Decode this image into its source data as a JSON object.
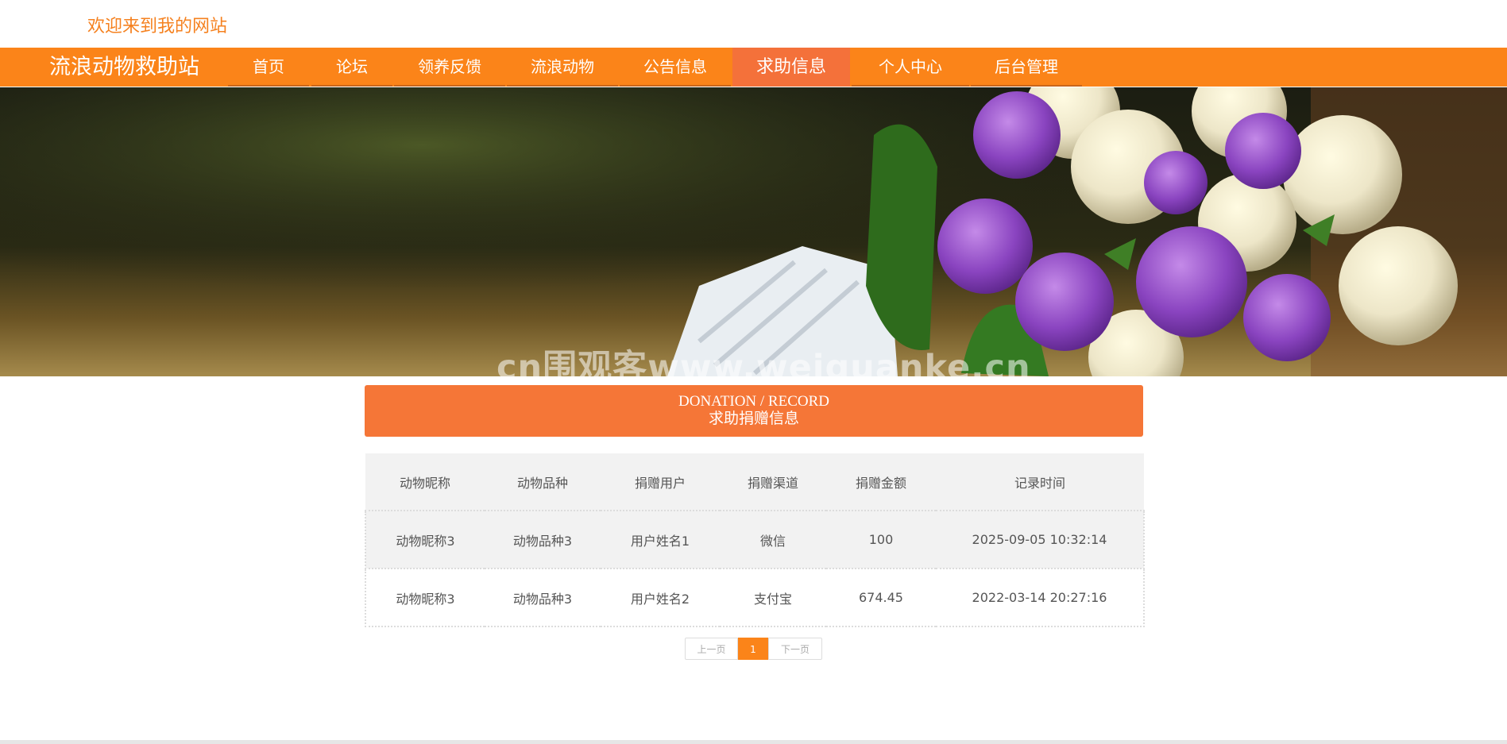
{
  "header": {
    "welcome": "欢迎来到我的网站"
  },
  "nav": {
    "site_title": "流浪动物救助站",
    "items": [
      {
        "label": "首页"
      },
      {
        "label": "论坛"
      },
      {
        "label": "领养反馈"
      },
      {
        "label": "流浪动物"
      },
      {
        "label": "公告信息"
      },
      {
        "label": "求助信息",
        "active": true
      },
      {
        "label": "个人中心"
      },
      {
        "label": "后台管理"
      }
    ],
    "color": "#fb8419",
    "active_color": "#f4713a"
  },
  "banner": {
    "watermark": "cn围观客www.weiguanke.cn"
  },
  "section": {
    "title_en": "DONATION / RECORD",
    "title_cn": "求助捐赠信息",
    "color": "#f57637"
  },
  "table": {
    "headers": [
      "动物昵称",
      "动物品种",
      "捐赠用户",
      "捐赠渠道",
      "捐赠金额",
      "记录时间"
    ],
    "rows": [
      [
        "动物昵称3",
        "动物品种3",
        "用户姓名1",
        "微信",
        "100",
        "2025-09-05 10:32:14"
      ],
      [
        "动物昵称3",
        "动物品种3",
        "用户姓名2",
        "支付宝",
        "674.45",
        "2022-03-14 20:27:16"
      ]
    ]
  },
  "pagination": {
    "prev": "上一页",
    "current": "1",
    "next": "下一页"
  }
}
